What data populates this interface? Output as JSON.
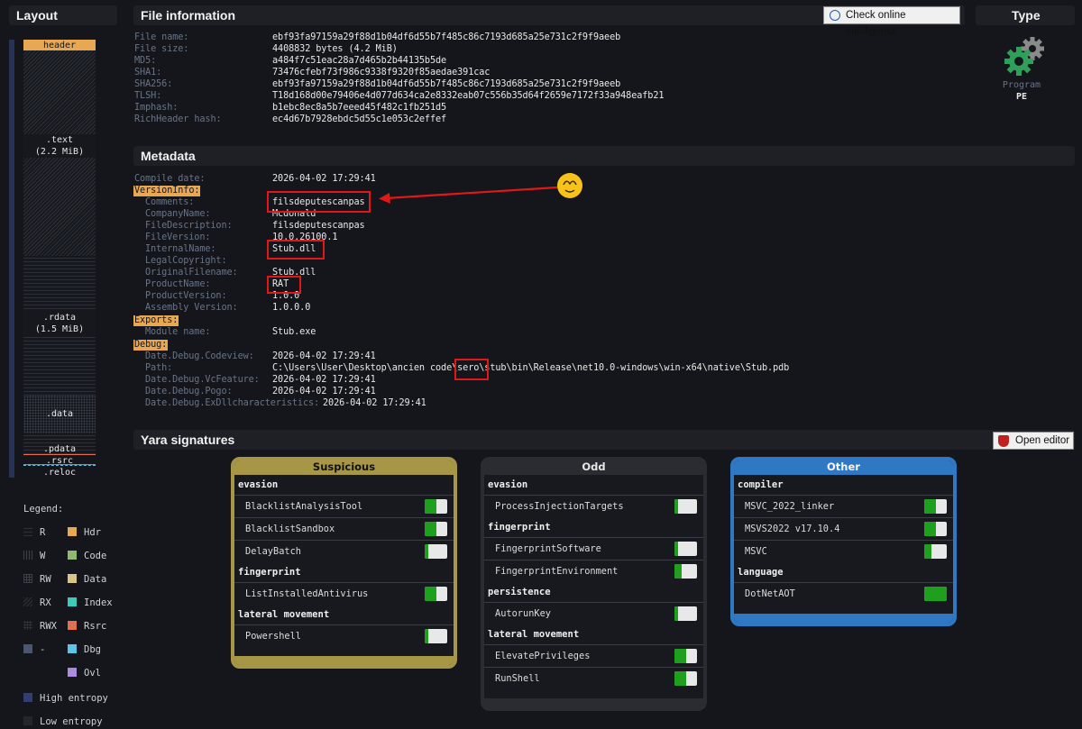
{
  "headers": {
    "layout": "Layout",
    "file_info": "File information",
    "type": "Type",
    "metadata": "Metadata",
    "yara": "Yara signatures"
  },
  "buttons": {
    "check_intel": "Check online intelligence",
    "open_editor": "Open editor"
  },
  "type_panel": {
    "icon": "gear-icon",
    "kind": "Program",
    "format": "PE"
  },
  "file_info": [
    {
      "k": "File name:",
      "v": "ebf93fa97159a29f88d1b04df6d55b7f485c86c7193d685a25e731c2f9f9aeeb"
    },
    {
      "k": "File size:",
      "v": "4408832 bytes (4.2 MiB)"
    },
    {
      "k": "MD5:",
      "v": "a484f7c51eac28a7d465b2b44135b5de"
    },
    {
      "k": "SHA1:",
      "v": "73476cfebf73f986c9338f9320f85aedae391cac"
    },
    {
      "k": "SHA256:",
      "v": "ebf93fa97159a29f88d1b04df6d55b7f485c86c7193d685a25e731c2f9f9aeeb"
    },
    {
      "k": "TLSH:",
      "v": "T18d168d00e79406e4d077d634ca2e8332eab07c556b35d64f2659e7172f33a948eafb21"
    },
    {
      "k": "Imphash:",
      "v": "b1ebc8ec8a5b7eeed45f482c1fb251d5"
    },
    {
      "k": "RichHeader hash:",
      "v": "ec4d67b7928ebdc5d55c1e053c2effef"
    }
  ],
  "metadata": {
    "compile_date": {
      "k": "Compile date:",
      "v": "2026-04-02 17:29:41"
    },
    "versioninfo_label": "VersionInfo:",
    "versioninfo": [
      {
        "k": "Comments:",
        "v": "filsdeputescanpas"
      },
      {
        "k": "CompanyName:",
        "v": "Mcdonald"
      },
      {
        "k": "FileDescription:",
        "v": "filsdeputescanpas"
      },
      {
        "k": "FileVersion:",
        "v": "10.0.26100.1"
      },
      {
        "k": "InternalName:",
        "v": "Stub.dll"
      },
      {
        "k": "LegalCopyright:",
        "v": ""
      },
      {
        "k": "OriginalFilename:",
        "v": "Stub.dll"
      },
      {
        "k": "ProductName:",
        "v": "RAT"
      },
      {
        "k": "ProductVersion:",
        "v": "1.0.0"
      },
      {
        "k": "Assembly Version:",
        "v": "1.0.0.0"
      }
    ],
    "exports_label": "Exports:",
    "exports": [
      {
        "k": "Module name:",
        "v": "Stub.exe"
      }
    ],
    "debug_label": "Debug:",
    "debug": [
      {
        "k": "Date.Debug.Codeview:",
        "v": "2026-04-02 17:29:41"
      },
      {
        "k": "Path:",
        "v": "C:\\Users\\User\\Desktop\\ancien code\\sero\\stub\\bin\\Release\\net10.0-windows\\win-x64\\native\\Stub.pdb"
      },
      {
        "k": "Date.Debug.VcFeature:",
        "v": "2026-04-02 17:29:41"
      },
      {
        "k": "Date.Debug.Pogo:",
        "v": "2026-04-02 17:29:41"
      },
      {
        "k": "Date.Debug.ExDllcharacteristics:",
        "v": "2026-04-02 17:29:41"
      }
    ]
  },
  "layout_sections": [
    {
      "name": "header",
      "label": "header"
    },
    {
      "name": "text",
      "label": ".text",
      "size": "(2.2 MiB)"
    },
    {
      "name": "rdata",
      "label": ".rdata",
      "size": "(1.5 MiB)"
    },
    {
      "name": "data",
      "label": ".data"
    },
    {
      "name": "pdata",
      "label": ".pdata"
    },
    {
      "name": "rsrc",
      "label": ".rsrc"
    },
    {
      "name": "reloc",
      "label": ".reloc"
    }
  ],
  "legend": {
    "title": "Legend:",
    "left": [
      "R",
      "W",
      "RW",
      "RX",
      "RWX",
      "-"
    ],
    "right": [
      "Hdr",
      "Code",
      "Data",
      "Index",
      "Rsrc",
      "Dbg",
      "Ovl"
    ],
    "high": "High entropy",
    "low": "Low entropy",
    "colors": {
      "hdr": "#e8a753",
      "code": "#8fb96e",
      "data": "#d9c58a",
      "index": "#3fc9b8",
      "rsrc": "#e07050",
      "dbg": "#5ec3e6",
      "ovl": "#a98be0",
      "high": "#2f3f73",
      "low": "#22262e"
    }
  },
  "yara": {
    "panels": [
      {
        "title": "Suspicious",
        "color": "#a89647",
        "groups": [
          {
            "cat": "evasion",
            "rules": [
              {
                "name": "BlacklistAnalysisTool",
                "fill": 0.5
              },
              {
                "name": "BlacklistSandbox",
                "fill": 0.5
              },
              {
                "name": "DelayBatch",
                "fill": 0.15
              }
            ]
          },
          {
            "cat": "fingerprint",
            "rules": [
              {
                "name": "ListInstalledAntivirus",
                "fill": 0.5
              }
            ]
          },
          {
            "cat": "lateral movement",
            "rules": [
              {
                "name": "Powershell",
                "fill": 0.15
              }
            ]
          }
        ]
      },
      {
        "title": "Odd",
        "color": "#2a2c31",
        "groups": [
          {
            "cat": "evasion",
            "rules": [
              {
                "name": "ProcessInjectionTargets",
                "fill": 0.15
              }
            ]
          },
          {
            "cat": "fingerprint",
            "rules": [
              {
                "name": "FingerprintSoftware",
                "fill": 0.15
              },
              {
                "name": "FingerprintEnvironment",
                "fill": 0.3
              }
            ]
          },
          {
            "cat": "persistence",
            "rules": [
              {
                "name": "AutorunKey",
                "fill": 0.15
              }
            ]
          },
          {
            "cat": "lateral movement",
            "rules": [
              {
                "name": "ElevatePrivileges",
                "fill": 0.5
              },
              {
                "name": "RunShell",
                "fill": 0.5
              }
            ]
          }
        ]
      },
      {
        "title": "Other",
        "color": "#2f78c4",
        "groups": [
          {
            "cat": "compiler",
            "rules": [
              {
                "name": "MSVC_2022_linker",
                "fill": 0.5
              },
              {
                "name": "MSVS2022 v17.10.4",
                "fill": 0.5
              },
              {
                "name": "MSVC",
                "fill": 0.3
              }
            ]
          },
          {
            "cat": "language",
            "rules": [
              {
                "name": "DotNetAOT",
                "fill": 1.0
              }
            ]
          }
        ]
      }
    ]
  }
}
